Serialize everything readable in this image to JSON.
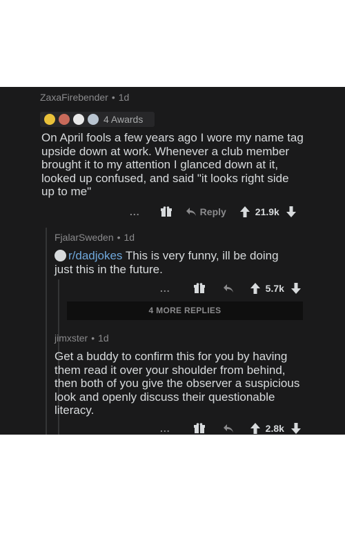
{
  "comment1": {
    "author": "ZaxaFirebender",
    "age": "1d",
    "awards_label": "4 Awards",
    "lines": [
      "On April fools a few years ago I wore my name tag",
      "upside down at work. Whenever a club member",
      "brought it to my attention I glanced down at it,",
      "looked up confused, and said \"it looks right side",
      "up to me\""
    ],
    "more": "...",
    "reply_label": "Reply",
    "score": "21.9k"
  },
  "comment2": {
    "author": "FjalarSweden",
    "age": "1d",
    "subreddit": "r/dadjokes",
    "line1_rest": " This is very funny, ill be doing",
    "line2": "just this in the future.",
    "more": "...",
    "score": "5.7k"
  },
  "more_replies": "4 MORE REPLIES",
  "comment3": {
    "author": "jimxster",
    "age": "1d",
    "lines": [
      "Get a buddy to confirm this for you by having",
      "them read it over your shoulder from behind,",
      "then both of you give the observer a suspicious",
      "look and openly discuss their questionable",
      "literacy."
    ],
    "more": "...",
    "score": "2.8k"
  },
  "colors": {
    "background": "#1a1a1b",
    "text": "#d7dadc",
    "meta": "#8a8a8c",
    "link": "#6fa8dc"
  },
  "icons": [
    "award-gold-icon",
    "award-silver-icon",
    "award-helpful-icon",
    "award-wholesome-icon",
    "gift-icon",
    "reply-icon",
    "upvote-icon",
    "downvote-icon"
  ]
}
